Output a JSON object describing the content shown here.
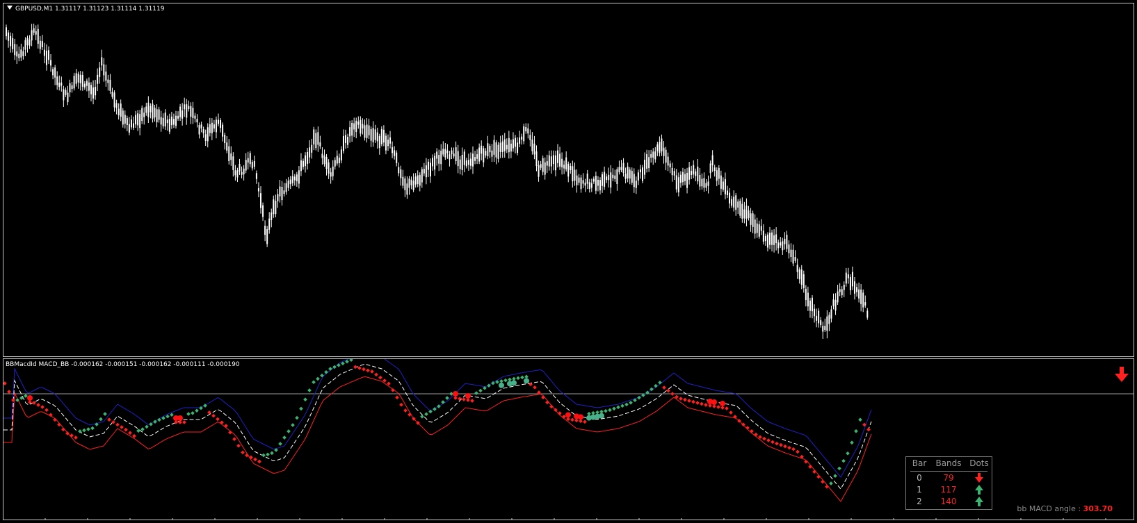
{
  "main_chart": {
    "symbol_line": "GBPUSD,M1  1.31117 1.31123 1.31114 1.31119",
    "bull_color": "#ffffff",
    "bear_color": "#ffffff"
  },
  "indicator": {
    "header": "BBMacdId MACD_BB -0.000162 -0.000151 -0.000162 -0.000111 -0.000190",
    "colors": {
      "upper_band": "#2020c8",
      "lower_band": "#ff2020",
      "middle_line": "#ffffff",
      "macd_line": "#ffffff",
      "up_dots": "#3cb371",
      "down_dots": "#ff2020",
      "cross_dots_up": "#48b08a",
      "cross_dots_down": "#ff1010",
      "zero_level": "#9a9a9a"
    },
    "alert_icon": "red-down-arrow-icon",
    "dashboard": {
      "headers": [
        "Bar",
        "Bands",
        "Dots"
      ],
      "rows": [
        {
          "bar": "0",
          "bands": "79",
          "dots_icon": "red-down-arrow-icon",
          "bands_color": "#ff2020"
        },
        {
          "bar": "1",
          "bands": "117",
          "dots_icon": "green-up-arrow-icon",
          "bands_color": "#ff2020"
        },
        {
          "bar": "2",
          "bands": "140",
          "dots_icon": "green-up-arrow-icon",
          "bands_color": "#ff2020"
        }
      ]
    },
    "angle_label": "bb MACD angle :",
    "angle_value": "303.70"
  }
}
